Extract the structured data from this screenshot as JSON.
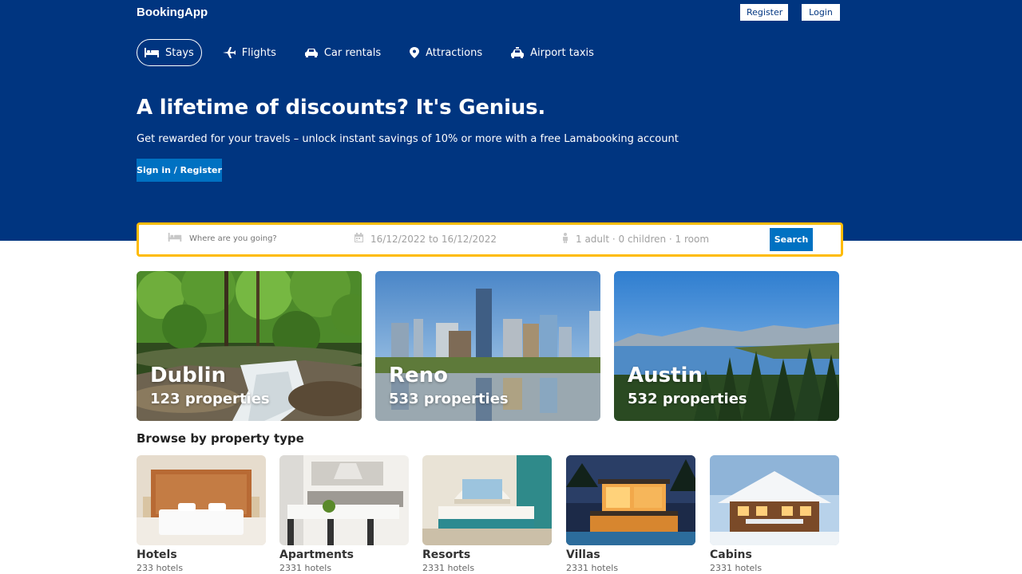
{
  "navbar": {
    "logo": "BookingApp",
    "register_label": "Register",
    "login_label": "Login"
  },
  "tabs": [
    {
      "label": "Stays",
      "icon": "bed-icon",
      "active": true
    },
    {
      "label": "Flights",
      "icon": "plane-icon",
      "active": false
    },
    {
      "label": "Car rentals",
      "icon": "car-icon",
      "active": false
    },
    {
      "label": "Attractions",
      "icon": "map-pin-icon",
      "active": false
    },
    {
      "label": "Airport taxis",
      "icon": "taxi-icon",
      "active": false
    }
  ],
  "hero": {
    "title": "A lifetime of discounts? It's Genius.",
    "subtitle": "Get rewarded for your travels – unlock instant savings of 10% or more with a free Lamabooking account",
    "button_label": "Sign in / Register"
  },
  "search": {
    "destination_placeholder": "Where are you going?",
    "dates": "16/12/2022 to 16/12/2022",
    "guests": "1 adult · 0 children · 1 room",
    "button_label": "Search"
  },
  "featured": [
    {
      "city": "Dublin",
      "properties": "123 properties"
    },
    {
      "city": "Reno",
      "properties": "533 properties"
    },
    {
      "city": "Austin",
      "properties": "532 properties"
    }
  ],
  "browse": {
    "title": "Browse by property type",
    "types": [
      {
        "name": "Hotels",
        "count": "233 hotels"
      },
      {
        "name": "Apartments",
        "count": "2331 hotels"
      },
      {
        "name": "Resorts",
        "count": "2331 hotels"
      },
      {
        "name": "Villas",
        "count": "2331 hotels"
      },
      {
        "name": "Cabins",
        "count": "2331 hotels"
      }
    ]
  },
  "colors": {
    "header_bg": "#003580",
    "accent": "#0071c2",
    "search_border": "#febb02"
  }
}
